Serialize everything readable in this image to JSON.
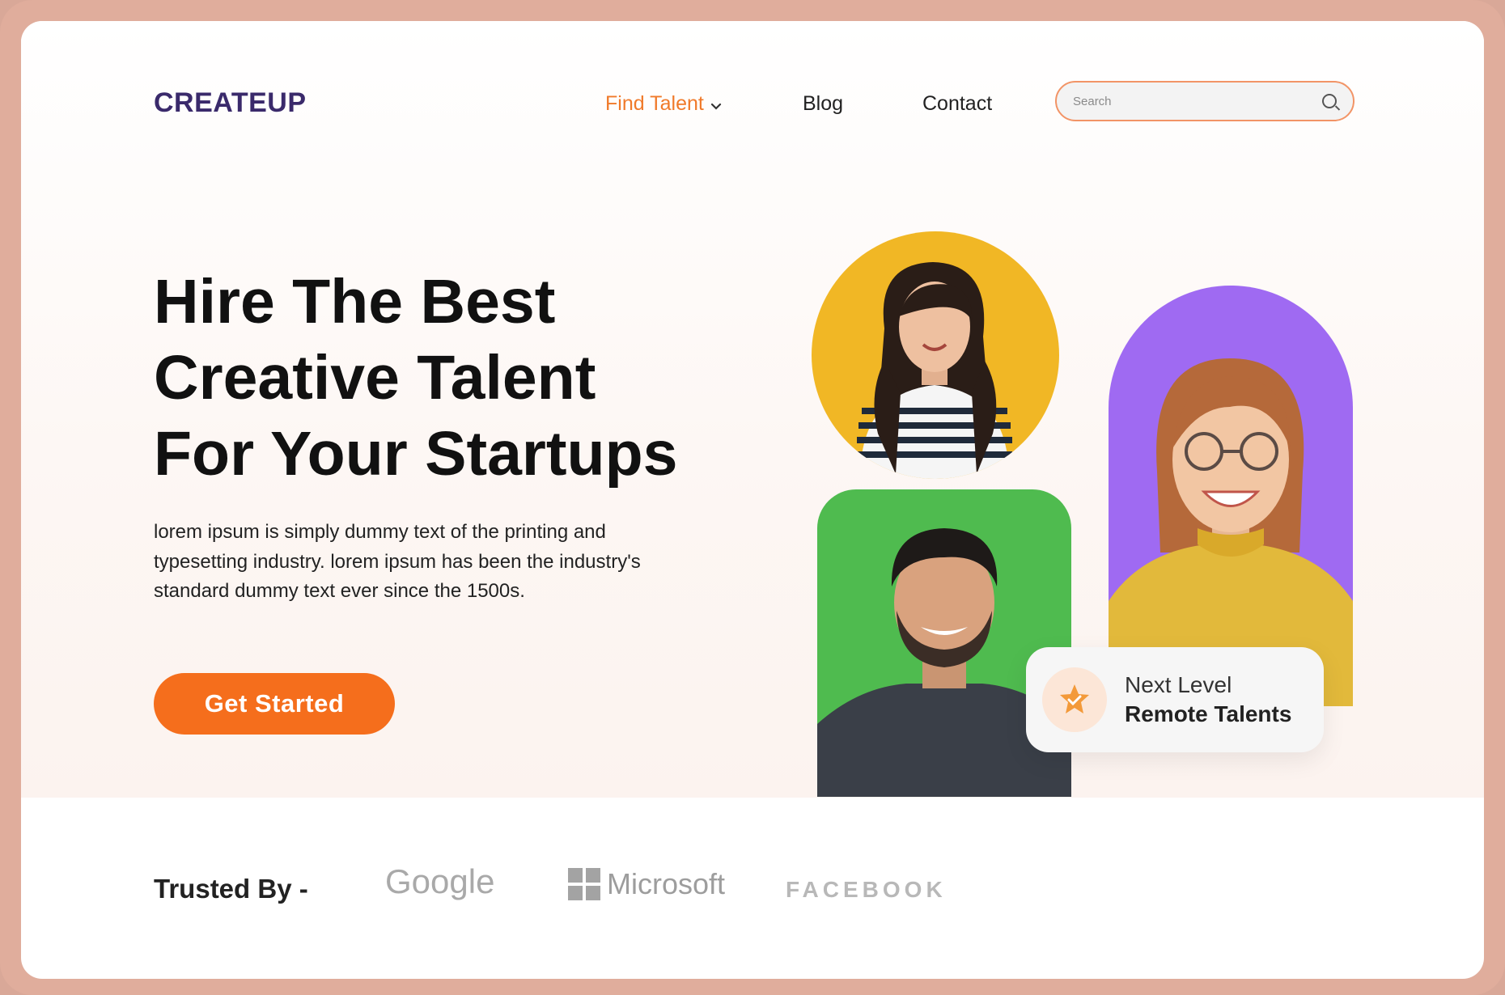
{
  "header": {
    "logo": "CREATEUP",
    "nav": {
      "find_talent": "Find Talent",
      "blog": "Blog",
      "contact": "Contact"
    },
    "search": {
      "placeholder": "Search",
      "value": ""
    }
  },
  "hero": {
    "headline_lines": [
      "Hire The Best",
      "Creative Talent",
      "For Your Startups"
    ],
    "description": "lorem ipsum is simply dummy text of the printing and typesetting industry. lorem ipsum has been the industry's standard dummy text ever since the 1500s.",
    "cta_label": "Get Started",
    "badge": {
      "line1": "Next Level",
      "line2": "Remote Talents"
    }
  },
  "trusted": {
    "label": "Trusted By -",
    "brands": [
      "Google",
      "Microsoft",
      "FACEBOOK"
    ]
  },
  "colors": {
    "accent": "#f56e1c",
    "logo": "#3a2a6b",
    "yellow": "#f1b725",
    "purple": "#9f6af2",
    "green": "#4fbb4f"
  }
}
